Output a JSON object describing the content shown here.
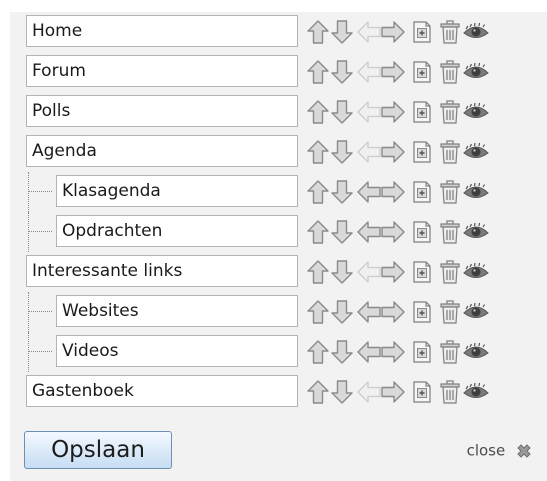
{
  "menu": {
    "items": [
      {
        "label": "Home",
        "level": 0,
        "can_outdent": false
      },
      {
        "label": "Forum",
        "level": 0,
        "can_outdent": false
      },
      {
        "label": "Polls",
        "level": 0,
        "can_outdent": false
      },
      {
        "label": "Agenda",
        "level": 0,
        "can_outdent": false
      },
      {
        "label": "Klasagenda",
        "level": 1,
        "can_outdent": true
      },
      {
        "label": "Opdrachten",
        "level": 1,
        "can_outdent": true
      },
      {
        "label": "Interessante links",
        "level": 0,
        "can_outdent": false
      },
      {
        "label": "Websites",
        "level": 1,
        "can_outdent": true
      },
      {
        "label": "Videos",
        "level": 1,
        "can_outdent": true
      },
      {
        "label": "Gastenboek",
        "level": 0,
        "can_outdent": false
      }
    ],
    "actions": [
      "up-arrow-icon",
      "down-arrow-icon",
      "left-arrow-icon",
      "right-arrow-icon",
      "add-page-icon",
      "trash-icon",
      "eye-icon"
    ]
  },
  "footer": {
    "save_label": "Opslaan",
    "close_label": "close"
  },
  "colors": {
    "arrow_fill": "#d9d9d9",
    "arrow_stroke": "#8a8a8a",
    "arrow_disabled_fill": "#f0f0f0",
    "arrow_disabled_stroke": "#cfcfcf",
    "button_gradient_top": "#f4f9ff",
    "button_gradient_bottom": "#c5ddf3"
  }
}
